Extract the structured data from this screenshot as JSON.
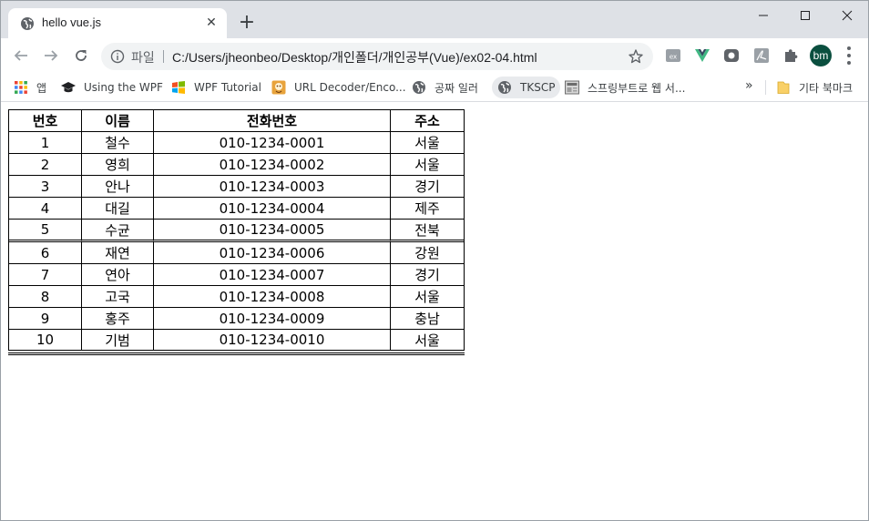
{
  "window": {
    "tab_title": "hello vue.js",
    "new_tab_label": "+"
  },
  "toolbar": {
    "omnibox_label": "파일",
    "url": "C:/Users/jheonbeo/Desktop/개인폴더/개인공부(Vue)/ex02-04.html",
    "profile_initials": "bm"
  },
  "bookmarks": {
    "items": [
      {
        "label": "앱",
        "icon": "apps-grid-icon"
      },
      {
        "label": "Using the WPF",
        "icon": "graduation-cap-icon"
      },
      {
        "label": "WPF Tutorial",
        "icon": "windows-logo-icon"
      },
      {
        "label": "URL Decoder/Enco...",
        "icon": "url-decoder-icon"
      },
      {
        "label": "공짜 일러",
        "icon": "globe-icon"
      },
      {
        "label": "TKSCP",
        "icon": "globe-icon"
      },
      {
        "label": "스프링부트로 웹 서...",
        "icon": "book-cover-icon"
      }
    ],
    "more_label": "»",
    "other_bookmarks_label": "기타 북마크"
  },
  "table": {
    "headers": [
      "번호",
      "이름",
      "전화번호",
      "주소"
    ],
    "rows": [
      [
        "1",
        "철수",
        "010-1234-0001",
        "서울"
      ],
      [
        "2",
        "영희",
        "010-1234-0002",
        "서울"
      ],
      [
        "3",
        "안나",
        "010-1234-0003",
        "경기"
      ],
      [
        "4",
        "대길",
        "010-1234-0004",
        "제주"
      ],
      [
        "5",
        "수균",
        "010-1234-0005",
        "전북"
      ],
      [
        "6",
        "재연",
        "010-1234-0006",
        "강원"
      ],
      [
        "7",
        "연아",
        "010-1234-0007",
        "경기"
      ],
      [
        "8",
        "고국",
        "010-1234-0008",
        "서울"
      ],
      [
        "9",
        "홍주",
        "010-1234-0009",
        "충남"
      ],
      [
        "10",
        "기범",
        "010-1234-0010",
        "서울"
      ]
    ]
  },
  "colors": {
    "tabstrip_bg": "#dee1e6",
    "omnibox_bg": "#f1f3f4",
    "avatar_bg": "#0b4f3f",
    "vue_green": "#41b883"
  }
}
